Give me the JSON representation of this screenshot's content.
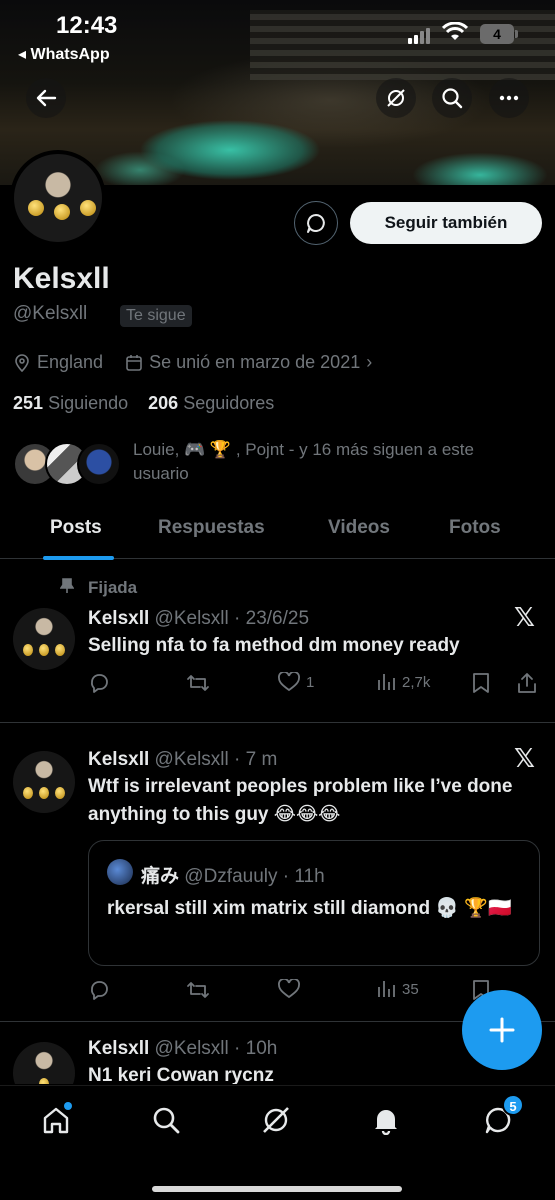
{
  "status_bar": {
    "time": "12:43",
    "back_app": "WhatsApp",
    "battery": "4"
  },
  "profile": {
    "name": "Kelsxll",
    "handle": "@Kelsxll",
    "follows_you": "Te sigue",
    "location": "England",
    "joined": "Se unió en marzo de 2021",
    "following_count": "251",
    "following_label": "Siguiendo",
    "followers_count": "206",
    "followers_label": "Seguidores",
    "followed_by": "Louie, 🎮 🏆 , Pojnt - y 16 más siguen a este usuario"
  },
  "buttons": {
    "follow": "Seguir también"
  },
  "tabs": [
    "Posts",
    "Respuestas",
    "Videos",
    "Fotos"
  ],
  "posts": [
    {
      "pinned_label": "Fijada",
      "name": "Kelsxll",
      "handle": "@Kelsxll",
      "time": "· 23/6/25",
      "text": "Selling nfa to fa method dm money ready",
      "likes": "1",
      "views": "2,7k"
    },
    {
      "name": "Kelsxll",
      "handle": "@Kelsxll",
      "time": "· 7 m",
      "text": "Wtf is irrelevant peoples problem like I’ve done anything to this guy 😂😂😂",
      "quote": {
        "name": "痛み",
        "handle": "@Dzfauuly",
        "time": "· 11h",
        "text": "rkersal still xim matrix still diamond 💀 🏆🇵🇱"
      },
      "views": "35"
    },
    {
      "name": "Kelsxll",
      "handle": "@Kelsxll",
      "time": "· 10h",
      "text": "N1 keri Cowan rycnz"
    }
  ],
  "nav": {
    "messages_badge": "5"
  },
  "icons": [
    "back-arrow-icon",
    "grok-icon",
    "search-icon",
    "more-icon",
    "message-icon",
    "location-icon",
    "calendar-icon",
    "pin-icon",
    "reply-icon",
    "retweet-icon",
    "like-icon",
    "views-icon",
    "bookmark-icon",
    "share-icon",
    "x-logo-icon",
    "plus-icon",
    "home-icon",
    "bell-icon",
    "mail-icon"
  ],
  "colors": {
    "accent": "#1d9bf0",
    "background": "#000000",
    "muted": "#71767b"
  }
}
